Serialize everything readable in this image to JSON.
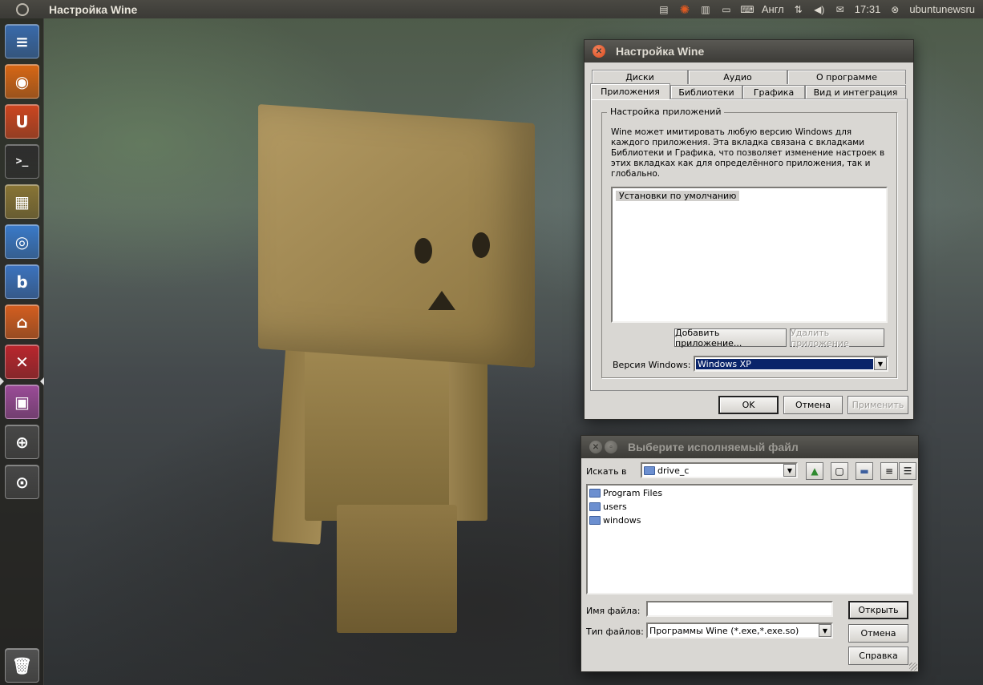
{
  "panel": {
    "app_title": "Настройка Wine",
    "keyboard_layout": "Англ",
    "clock": "17:31",
    "user": "ubuntunewsru"
  },
  "launcher": {
    "items": [
      {
        "name": "libreoffice-writer-icon",
        "glyph": "≡",
        "color": "#3a6fb5"
      },
      {
        "name": "firefox-icon",
        "glyph": "◉",
        "color": "#e36b14"
      },
      {
        "name": "ubuntu-software-center-icon",
        "glyph": "U",
        "color": "#d8471f"
      },
      {
        "name": "terminal-icon",
        "glyph": ">_",
        "color": "#2e2e2e"
      },
      {
        "name": "archive-manager-icon",
        "glyph": "▦",
        "color": "#8f7a36"
      },
      {
        "name": "chromium-icon",
        "glyph": "◎",
        "color": "#3b7fd4"
      },
      {
        "name": "bookmark-app-icon",
        "glyph": "b",
        "color": "#3d78c9"
      },
      {
        "name": "home-folder-icon",
        "glyph": "⌂",
        "color": "#e0621f"
      },
      {
        "name": "wine-config-icon",
        "glyph": "✕",
        "color": "#c4262e"
      },
      {
        "name": "workspace-switcher-icon",
        "glyph": "▣",
        "color": "#a34ea0"
      },
      {
        "name": "zoom-in-lens-icon",
        "glyph": "⊕",
        "color": "#4a4a4a"
      },
      {
        "name": "search-lens-icon",
        "glyph": "⊙",
        "color": "#4a4a4a"
      },
      {
        "name": "trash-icon",
        "glyph": "🗑",
        "color": "#555555"
      }
    ]
  },
  "wine": {
    "title": "Настройка Wine",
    "tabs_back": [
      "Диски",
      "Аудио",
      "О программе"
    ],
    "tabs_front": [
      "Приложения",
      "Библиотеки",
      "Графика",
      "Вид и интеграция"
    ],
    "group_title": "Настройка приложений",
    "description": "Wine может имитировать любую версию Windows для каждого приложения. Эта вкладка связана с вкладками Библиотеки и Графика, что позволяет изменение настроек в этих вкладках как для определённого приложения, так и глобально.",
    "list_item": "Установки по умолчанию",
    "add_button": "Добавить приложение...",
    "remove_button": "Удалить приложение",
    "version_label": "Версия Windows:",
    "version_value": "Windows XP",
    "ok": "OK",
    "cancel": "Отмена",
    "apply": "Применить"
  },
  "filedlg": {
    "title": "Выберите исполняемый файл",
    "lookin_label": "Искать в",
    "lookin_value": "drive_c",
    "items": [
      "Program Files",
      "users",
      "windows"
    ],
    "filename_label": "Имя файла:",
    "filename_value": "",
    "filetype_label": "Тип файлов:",
    "filetype_value": "Программы Wine (*.exe,*.exe.so)",
    "open": "Открыть",
    "cancel": "Отмена",
    "help": "Справка"
  }
}
